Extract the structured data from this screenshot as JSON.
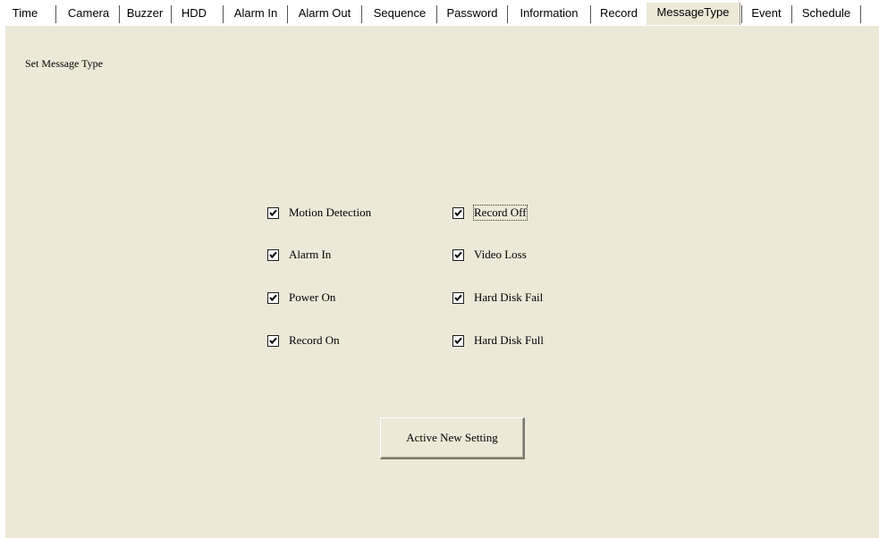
{
  "tabs": [
    {
      "label": "Time",
      "active": false
    },
    {
      "label": "Camera",
      "active": false
    },
    {
      "label": "Buzzer",
      "active": false
    },
    {
      "label": "HDD",
      "active": false
    },
    {
      "label": "Alarm In",
      "active": false
    },
    {
      "label": "Alarm Out",
      "active": false
    },
    {
      "label": "Sequence",
      "active": false
    },
    {
      "label": "Password",
      "active": false
    },
    {
      "label": "Information",
      "active": false
    },
    {
      "label": "Record",
      "active": false
    },
    {
      "label": "MessageType",
      "active": true
    },
    {
      "label": "Event",
      "active": false
    },
    {
      "label": "Schedule",
      "active": false
    }
  ],
  "panel": {
    "title": "Set Message Type",
    "options_left": [
      {
        "label": "Motion Detection",
        "checked": true
      },
      {
        "label": "Alarm In",
        "checked": true
      },
      {
        "label": "Power On",
        "checked": true
      },
      {
        "label": "Record On",
        "checked": true
      }
    ],
    "options_right": [
      {
        "label": "Record Off",
        "checked": true
      },
      {
        "label": "Video Loss",
        "checked": true
      },
      {
        "label": "Hard Disk Fail",
        "checked": true
      },
      {
        "label": "Hard Disk Full",
        "checked": true
      }
    ],
    "apply_button": "Active New Setting"
  },
  "colors": {
    "panel_background": "#ece9d8"
  }
}
